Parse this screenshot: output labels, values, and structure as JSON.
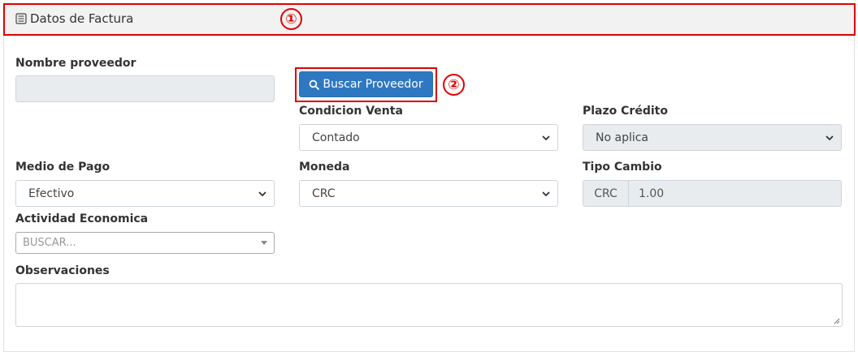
{
  "header": {
    "title": "Datos de Factura",
    "icon": "list-icon"
  },
  "annotations": {
    "one": "①",
    "two": "②"
  },
  "colors": {
    "primary": "#2e78c2",
    "annotation": "#e00000"
  },
  "form": {
    "nombre_proveedor": {
      "label": "Nombre proveedor",
      "value": ""
    },
    "buscar_button": {
      "label": "Buscar Proveedor",
      "icon": "search-icon"
    },
    "condicion_venta": {
      "label": "Condicion Venta",
      "value": "Contado"
    },
    "plazo_credito": {
      "label": "Plazo Crédito",
      "value": "No aplica"
    },
    "medio_pago": {
      "label": "Medio de Pago",
      "value": "Efectivo"
    },
    "moneda": {
      "label": "Moneda",
      "value": "CRC"
    },
    "tipo_cambio": {
      "label": "Tipo Cambio",
      "addon": "CRC",
      "value": "1.00"
    },
    "actividad_economica": {
      "label": "Actividad Economica",
      "placeholder": "BUSCAR..."
    },
    "observaciones": {
      "label": "Observaciones",
      "value": ""
    }
  }
}
